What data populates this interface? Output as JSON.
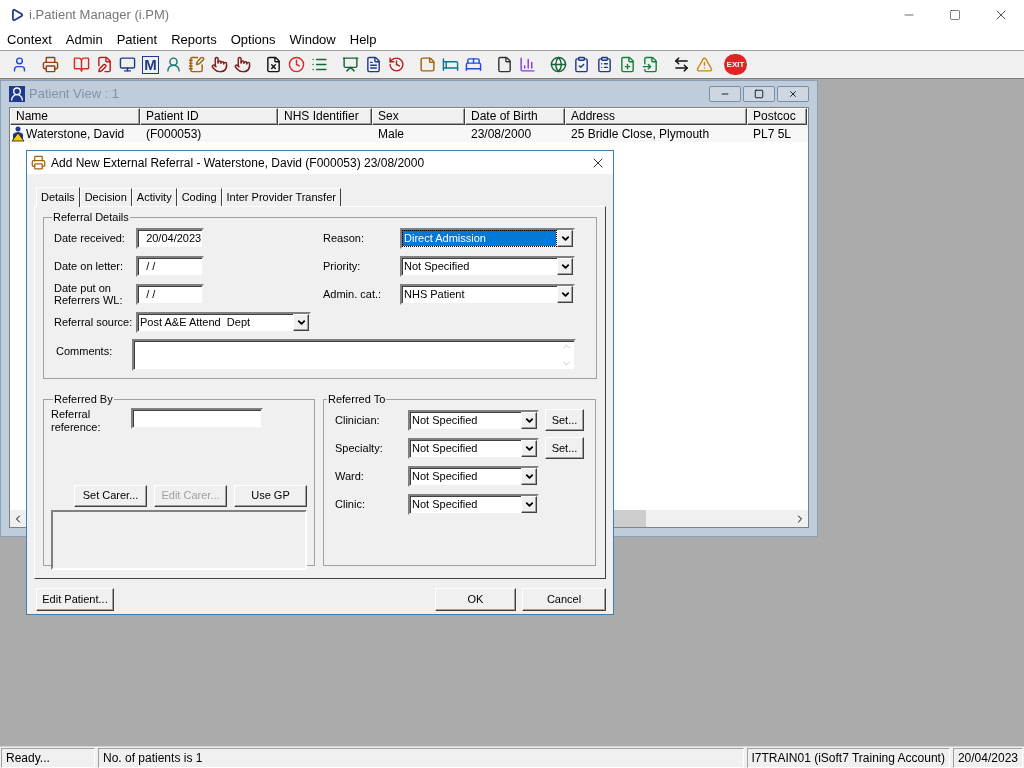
{
  "app": {
    "title": "i.Patient Manager (i.PM)"
  },
  "menu": [
    "Context",
    "Admin",
    "Patient",
    "Reports",
    "Options",
    "Window",
    "Help"
  ],
  "toolbar": {
    "m_glyph": "M",
    "exit_glyph": "EXIT"
  },
  "patient_view": {
    "title": "Patient View : 1",
    "columns": [
      "Name",
      "Patient ID",
      "NHS Identifier",
      "Sex",
      "Date of Birth",
      "Address",
      "Postcoc"
    ],
    "rows": [
      {
        "selected": false,
        "cells": [
          "Waterstone, David",
          "(F000053)",
          "",
          "Male",
          "23/08/2000",
          "25 Bridle Close, Plymouth",
          "PL7 5L"
        ]
      }
    ]
  },
  "dialog": {
    "title": "Add New External Referral - Waterstone, David (F000053) 23/08/2000",
    "tabs": [
      {
        "label": "Details",
        "selected": true
      },
      {
        "label": "Decision",
        "selected": false
      },
      {
        "label": "Activity",
        "selected": false
      },
      {
        "label": "Coding",
        "selected": false
      },
      {
        "label": "Inter Provider Transfer",
        "selected": false
      }
    ],
    "referral_details": {
      "title": "Referral Details",
      "left_fields": [
        {
          "label": "Date received:",
          "value": "20/04/2023",
          "kind": "text"
        },
        {
          "label": "Date on letter:",
          "value": "/ /",
          "kind": "text"
        },
        {
          "label": "Date put on Referrers WL:",
          "value": "/ /",
          "kind": "text"
        },
        {
          "label": "Referral source:",
          "value": "Post A&E Attend  Dept",
          "kind": "dropdown",
          "highlighted": false
        }
      ],
      "right_fields": [
        {
          "label": "Reason:",
          "value": "Direct Admission",
          "kind": "dropdown",
          "highlighted": true
        },
        {
          "label": "Priority:",
          "value": "Not Specified",
          "kind": "dropdown",
          "highlighted": false
        },
        {
          "label": "Admin. cat.:",
          "value": "NHS Patient",
          "kind": "dropdown",
          "highlighted": false
        }
      ],
      "comments": {
        "label": "Comments:"
      }
    },
    "referred_by": {
      "title": "Referred By",
      "reference_label": "Referral reference:",
      "buttons": [
        {
          "label": "Set Carer...",
          "disabled": false
        },
        {
          "label": "Edit Carer...",
          "disabled": true
        },
        {
          "label": "Use GP",
          "disabled": false
        }
      ]
    },
    "referred_to": {
      "title": "Referred To",
      "fields": [
        {
          "label": "Clinician:",
          "value": "Not Specified",
          "set_button": "Set..."
        },
        {
          "label": "Specialty:",
          "value": "Not Specified",
          "set_button": "Set..."
        },
        {
          "label": "Ward:",
          "value": "Not Specified"
        },
        {
          "label": "Clinic:",
          "value": "Not Specified"
        }
      ]
    },
    "buttons": {
      "edit_patient": "Edit Patient...",
      "ok": "OK",
      "cancel": "Cancel"
    }
  },
  "status_bar": [
    "Ready...",
    "No. of patients is 1",
    "I7TRAIN01 (iSoft7 Training Account)",
    "20/04/2023"
  ]
}
